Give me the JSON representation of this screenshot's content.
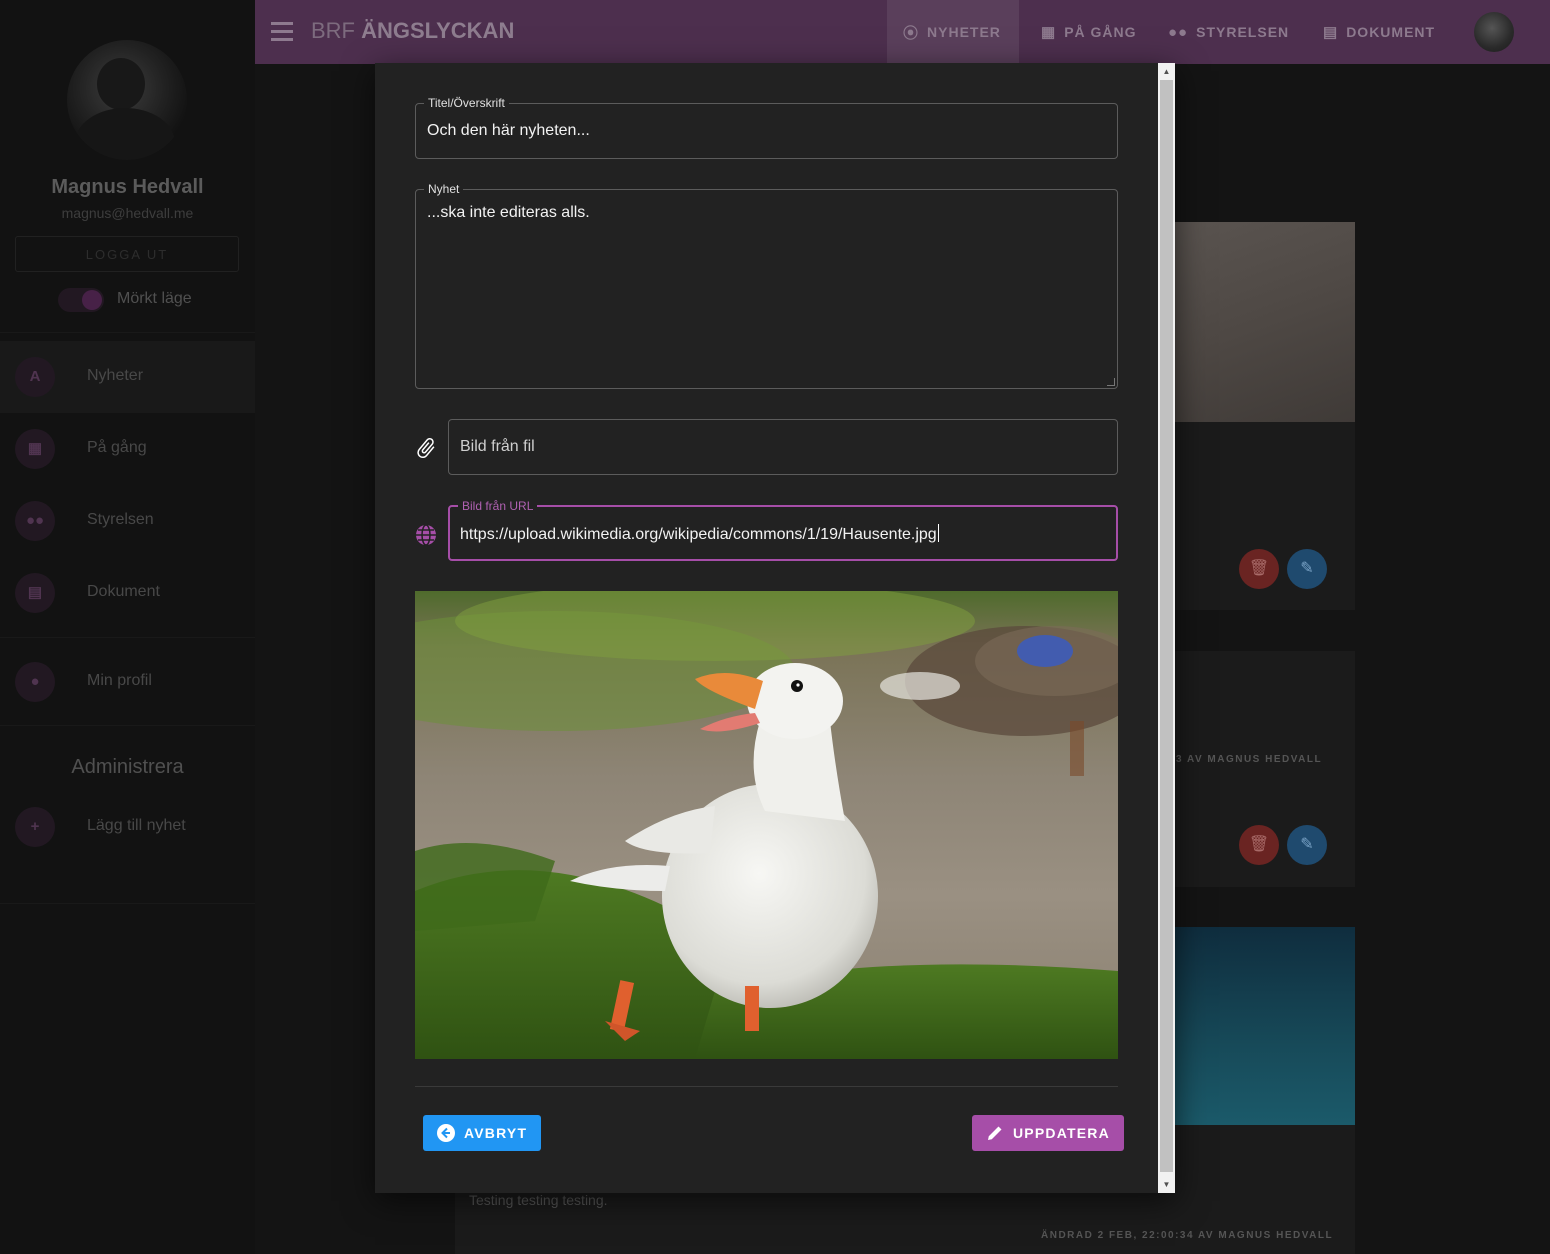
{
  "app": {
    "brand_prefix": "BRF",
    "brand_name": "ÄNGSLYCKAN"
  },
  "topnav": {
    "items": [
      {
        "label": "NYHETER",
        "icon": "antenna-icon",
        "active": true
      },
      {
        "label": "PÅ GÅNG",
        "icon": "calendar-icon",
        "active": false
      },
      {
        "label": "STYRELSEN",
        "icon": "people-icon",
        "active": false
      },
      {
        "label": "DOKUMENT",
        "icon": "document-icon",
        "active": false
      }
    ]
  },
  "sidebar": {
    "user_name": "Magnus Hedvall",
    "user_email": "magnus@hedvall.me",
    "logout_label": "LOGGA UT",
    "dark_mode_label": "Mörkt läge",
    "dark_mode_on": true,
    "items": [
      {
        "label": "Nyheter",
        "icon": "antenna-icon",
        "active": true
      },
      {
        "label": "På gång",
        "icon": "calendar-icon",
        "active": false
      },
      {
        "label": "Styrelsen",
        "icon": "people-icon",
        "active": false
      },
      {
        "label": "Dokument",
        "icon": "document-icon",
        "active": false
      },
      {
        "label": "Min profil",
        "icon": "person-icon",
        "active": false
      }
    ],
    "admin_title": "Administrera",
    "admin_items": [
      {
        "label": "Lägg till nyhet",
        "icon": "plus-circle-icon"
      }
    ]
  },
  "background": {
    "meta_1": "3 AV MAGNUS HEDVALL",
    "meta_2": "ÄNDRAD 2 FEB, 22:00:34 AV MAGNUS HEDVALL",
    "text_1": "Testing testing testing."
  },
  "modal": {
    "title_field": {
      "label": "Titel/Överskrift",
      "value": "Och den här nyheten..."
    },
    "body_field": {
      "label": "Nyhet",
      "value": "...ska inte editeras alls."
    },
    "file_field": {
      "placeholder": "Bild från fil",
      "icon": "paperclip-icon"
    },
    "url_field": {
      "label": "Bild från URL",
      "value": "https://upload.wikimedia.org/wikipedia/commons/1/19/Hausente.jpg",
      "icon": "globe-icon"
    },
    "cancel_label": "AVBRYT",
    "update_label": "UPPDATERA"
  },
  "colors": {
    "accent": "#a64ea8",
    "primary": "#2196f3",
    "topbar": "#4d2f4e",
    "modal_bg": "#222222"
  }
}
